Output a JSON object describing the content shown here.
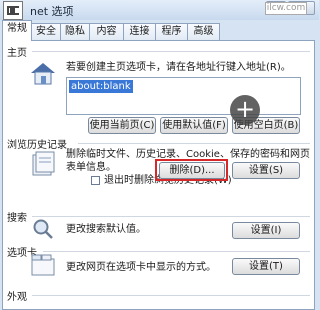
{
  "window": {
    "title": "net 选项"
  },
  "tabs": [
    "常规",
    "安全",
    "隐私",
    "内容",
    "连接",
    "程序",
    "高级"
  ],
  "home": {
    "section": "主页",
    "desc": "若要创建主页选项卡，请在各地址行键入地址(R)。",
    "url": "about:blank",
    "buttons": {
      "current": "使用当前页(C)",
      "default": "使用默认值(F)",
      "blank": "使用空白页(B)"
    }
  },
  "history": {
    "section": "浏览历史记录",
    "desc_line1": "删除临时文件、历史记录、Cookie、保存的密码和网页",
    "desc_line2": "表单信息。",
    "checkbox_label": "退出时删除浏览历史记录(W)",
    "delete_button": "删除(D)...",
    "settings_button": "设置(S)"
  },
  "search": {
    "section": "搜索",
    "desc": "更改搜索默认值。",
    "settings_button": "设置(I)"
  },
  "tabsection": {
    "section": "选项卡",
    "desc": "更改网页在选项卡中显示的方式。",
    "settings_button": "设置(T)"
  },
  "appearance": {
    "section": "外观"
  },
  "badge": "ilcw.com"
}
